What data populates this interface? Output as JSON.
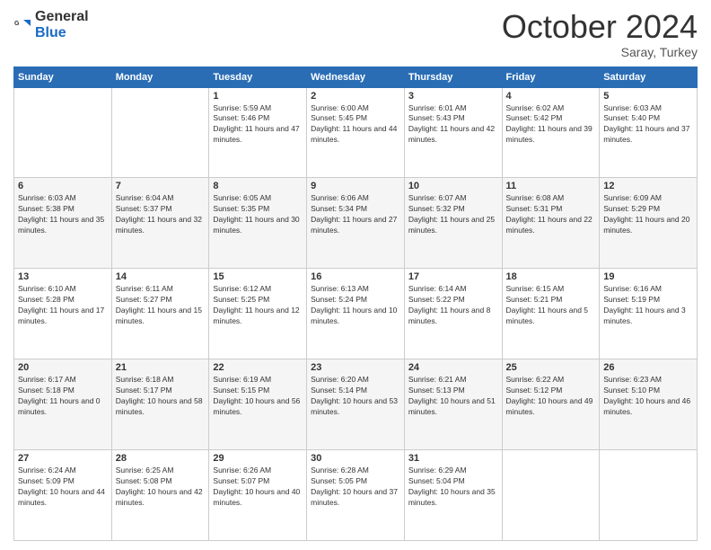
{
  "header": {
    "logo_general": "General",
    "logo_blue": "Blue",
    "month": "October 2024",
    "location": "Saray, Turkey"
  },
  "weekdays": [
    "Sunday",
    "Monday",
    "Tuesday",
    "Wednesday",
    "Thursday",
    "Friday",
    "Saturday"
  ],
  "weeks": [
    [
      {
        "day": "",
        "info": ""
      },
      {
        "day": "",
        "info": ""
      },
      {
        "day": "1",
        "info": "Sunrise: 5:59 AM\nSunset: 5:46 PM\nDaylight: 11 hours and 47 minutes."
      },
      {
        "day": "2",
        "info": "Sunrise: 6:00 AM\nSunset: 5:45 PM\nDaylight: 11 hours and 44 minutes."
      },
      {
        "day": "3",
        "info": "Sunrise: 6:01 AM\nSunset: 5:43 PM\nDaylight: 11 hours and 42 minutes."
      },
      {
        "day": "4",
        "info": "Sunrise: 6:02 AM\nSunset: 5:42 PM\nDaylight: 11 hours and 39 minutes."
      },
      {
        "day": "5",
        "info": "Sunrise: 6:03 AM\nSunset: 5:40 PM\nDaylight: 11 hours and 37 minutes."
      }
    ],
    [
      {
        "day": "6",
        "info": "Sunrise: 6:03 AM\nSunset: 5:38 PM\nDaylight: 11 hours and 35 minutes."
      },
      {
        "day": "7",
        "info": "Sunrise: 6:04 AM\nSunset: 5:37 PM\nDaylight: 11 hours and 32 minutes."
      },
      {
        "day": "8",
        "info": "Sunrise: 6:05 AM\nSunset: 5:35 PM\nDaylight: 11 hours and 30 minutes."
      },
      {
        "day": "9",
        "info": "Sunrise: 6:06 AM\nSunset: 5:34 PM\nDaylight: 11 hours and 27 minutes."
      },
      {
        "day": "10",
        "info": "Sunrise: 6:07 AM\nSunset: 5:32 PM\nDaylight: 11 hours and 25 minutes."
      },
      {
        "day": "11",
        "info": "Sunrise: 6:08 AM\nSunset: 5:31 PM\nDaylight: 11 hours and 22 minutes."
      },
      {
        "day": "12",
        "info": "Sunrise: 6:09 AM\nSunset: 5:29 PM\nDaylight: 11 hours and 20 minutes."
      }
    ],
    [
      {
        "day": "13",
        "info": "Sunrise: 6:10 AM\nSunset: 5:28 PM\nDaylight: 11 hours and 17 minutes."
      },
      {
        "day": "14",
        "info": "Sunrise: 6:11 AM\nSunset: 5:27 PM\nDaylight: 11 hours and 15 minutes."
      },
      {
        "day": "15",
        "info": "Sunrise: 6:12 AM\nSunset: 5:25 PM\nDaylight: 11 hours and 12 minutes."
      },
      {
        "day": "16",
        "info": "Sunrise: 6:13 AM\nSunset: 5:24 PM\nDaylight: 11 hours and 10 minutes."
      },
      {
        "day": "17",
        "info": "Sunrise: 6:14 AM\nSunset: 5:22 PM\nDaylight: 11 hours and 8 minutes."
      },
      {
        "day": "18",
        "info": "Sunrise: 6:15 AM\nSunset: 5:21 PM\nDaylight: 11 hours and 5 minutes."
      },
      {
        "day": "19",
        "info": "Sunrise: 6:16 AM\nSunset: 5:19 PM\nDaylight: 11 hours and 3 minutes."
      }
    ],
    [
      {
        "day": "20",
        "info": "Sunrise: 6:17 AM\nSunset: 5:18 PM\nDaylight: 11 hours and 0 minutes."
      },
      {
        "day": "21",
        "info": "Sunrise: 6:18 AM\nSunset: 5:17 PM\nDaylight: 10 hours and 58 minutes."
      },
      {
        "day": "22",
        "info": "Sunrise: 6:19 AM\nSunset: 5:15 PM\nDaylight: 10 hours and 56 minutes."
      },
      {
        "day": "23",
        "info": "Sunrise: 6:20 AM\nSunset: 5:14 PM\nDaylight: 10 hours and 53 minutes."
      },
      {
        "day": "24",
        "info": "Sunrise: 6:21 AM\nSunset: 5:13 PM\nDaylight: 10 hours and 51 minutes."
      },
      {
        "day": "25",
        "info": "Sunrise: 6:22 AM\nSunset: 5:12 PM\nDaylight: 10 hours and 49 minutes."
      },
      {
        "day": "26",
        "info": "Sunrise: 6:23 AM\nSunset: 5:10 PM\nDaylight: 10 hours and 46 minutes."
      }
    ],
    [
      {
        "day": "27",
        "info": "Sunrise: 6:24 AM\nSunset: 5:09 PM\nDaylight: 10 hours and 44 minutes."
      },
      {
        "day": "28",
        "info": "Sunrise: 6:25 AM\nSunset: 5:08 PM\nDaylight: 10 hours and 42 minutes."
      },
      {
        "day": "29",
        "info": "Sunrise: 6:26 AM\nSunset: 5:07 PM\nDaylight: 10 hours and 40 minutes."
      },
      {
        "day": "30",
        "info": "Sunrise: 6:28 AM\nSunset: 5:05 PM\nDaylight: 10 hours and 37 minutes."
      },
      {
        "day": "31",
        "info": "Sunrise: 6:29 AM\nSunset: 5:04 PM\nDaylight: 10 hours and 35 minutes."
      },
      {
        "day": "",
        "info": ""
      },
      {
        "day": "",
        "info": ""
      }
    ]
  ]
}
